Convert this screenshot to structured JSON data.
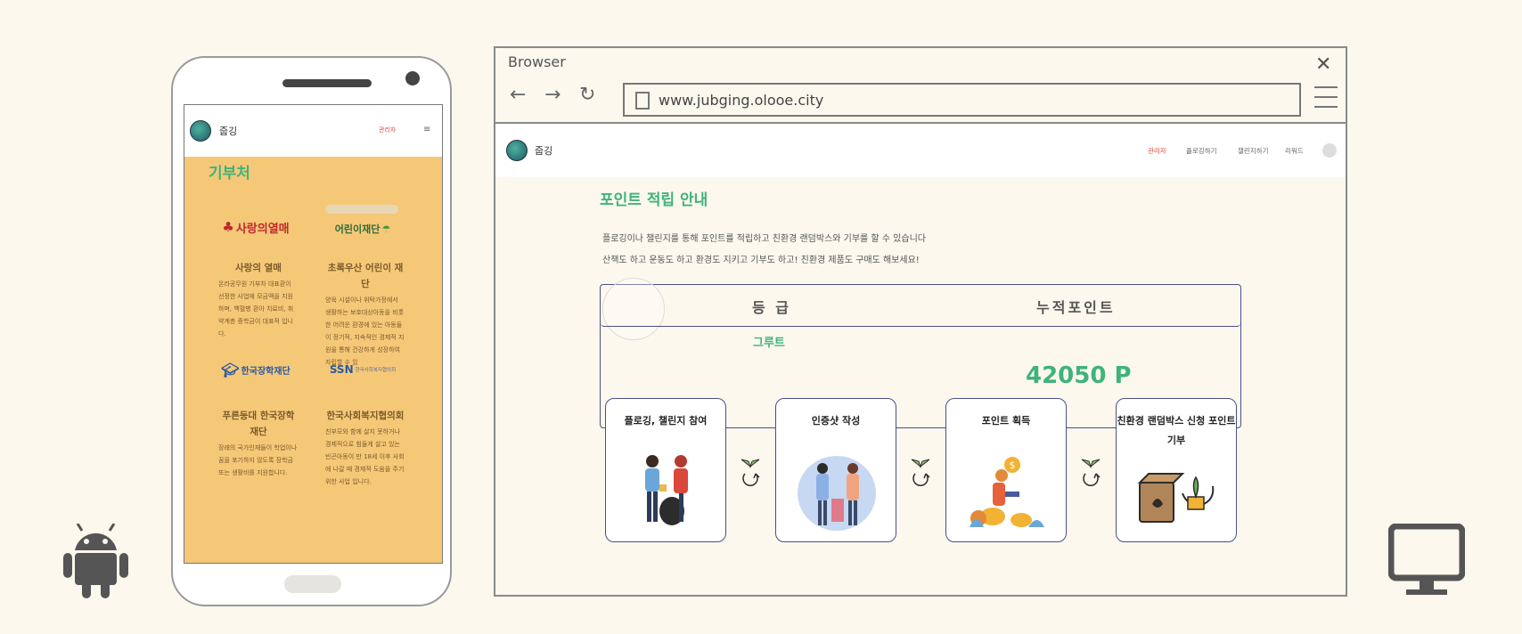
{
  "phone": {
    "brand": "줍깅",
    "admin": "관리자",
    "menu_icon": "≡",
    "section_title": "기부처",
    "orgs": [
      {
        "logo_text": "사랑의열매",
        "name": "사랑의 열매",
        "desc": "온라공무원 기부차 대표환이 선정한 사업에 모금액을 지원하며, 백혈병 환아 치료비, 취약계층 중학금이 대표적 입니다."
      },
      {
        "logo_text": "어린이재단",
        "name": "초록우산 어린이 재단",
        "desc": "양육 시설이나 위탁가정에서 생활하는 보호대상아동을 비롯한 어려운 환경에 있는 아동들이 정기적, 지속적인 경제적 지원을 통해 건강하게 성장하여 자립할 수 있"
      },
      {
        "logo_text": "한국장학재단",
        "name": "푸른등대 한국장학재단",
        "desc": "장래의 국가인재들이 학업이나 꿈을 포기하지 않도록 장학금 또는 생활비를 지원합니다."
      },
      {
        "logo_text": "SSN",
        "logo_sub": "한국사회복지협의회",
        "name": "한국사회복지협의회",
        "desc": "친부모와 함께 살지 못하거나 경제적으로 힘들게 살고 있는 빈곤아동이 만 18세 이후 사회에 나갈 때 경제적 도움을 주기 위한 사업 입니다."
      }
    ]
  },
  "browser": {
    "title": "Browser",
    "url": "www.jubging.olooe.city",
    "site": {
      "brand": "줍깅",
      "nav": [
        "관리자",
        "플로깅하기",
        "챌린지하기",
        "리워드"
      ]
    },
    "page_title": "포인트 적립 안내",
    "desc_lines": [
      "플로깅이나 챌린지를 통해 포인트를 적립하고 친환경 랜덤박스와 기부를 할 수 있습니다",
      "산책도 하고 운동도 하고 환경도 지키고 기부도 하고! 친환경 제품도 구매도 해보세요!"
    ],
    "card": {
      "grade_label": "등 급",
      "points_label": "누적포인트",
      "grade_value": "그루트",
      "points_value": "42050 P"
    },
    "steps": [
      {
        "label": "플로깅, 챌린지 참여"
      },
      {
        "label": "인증샷 작성"
      },
      {
        "label": "포인트 획득"
      },
      {
        "label": "친환경 랜덤박스 신청 포인트 기부"
      }
    ]
  },
  "colors": {
    "accent_green": "#3fb37a",
    "admin_red": "#d84a3a",
    "phone_bg": "#f5c878",
    "page_bg": "#fcf8ee"
  }
}
